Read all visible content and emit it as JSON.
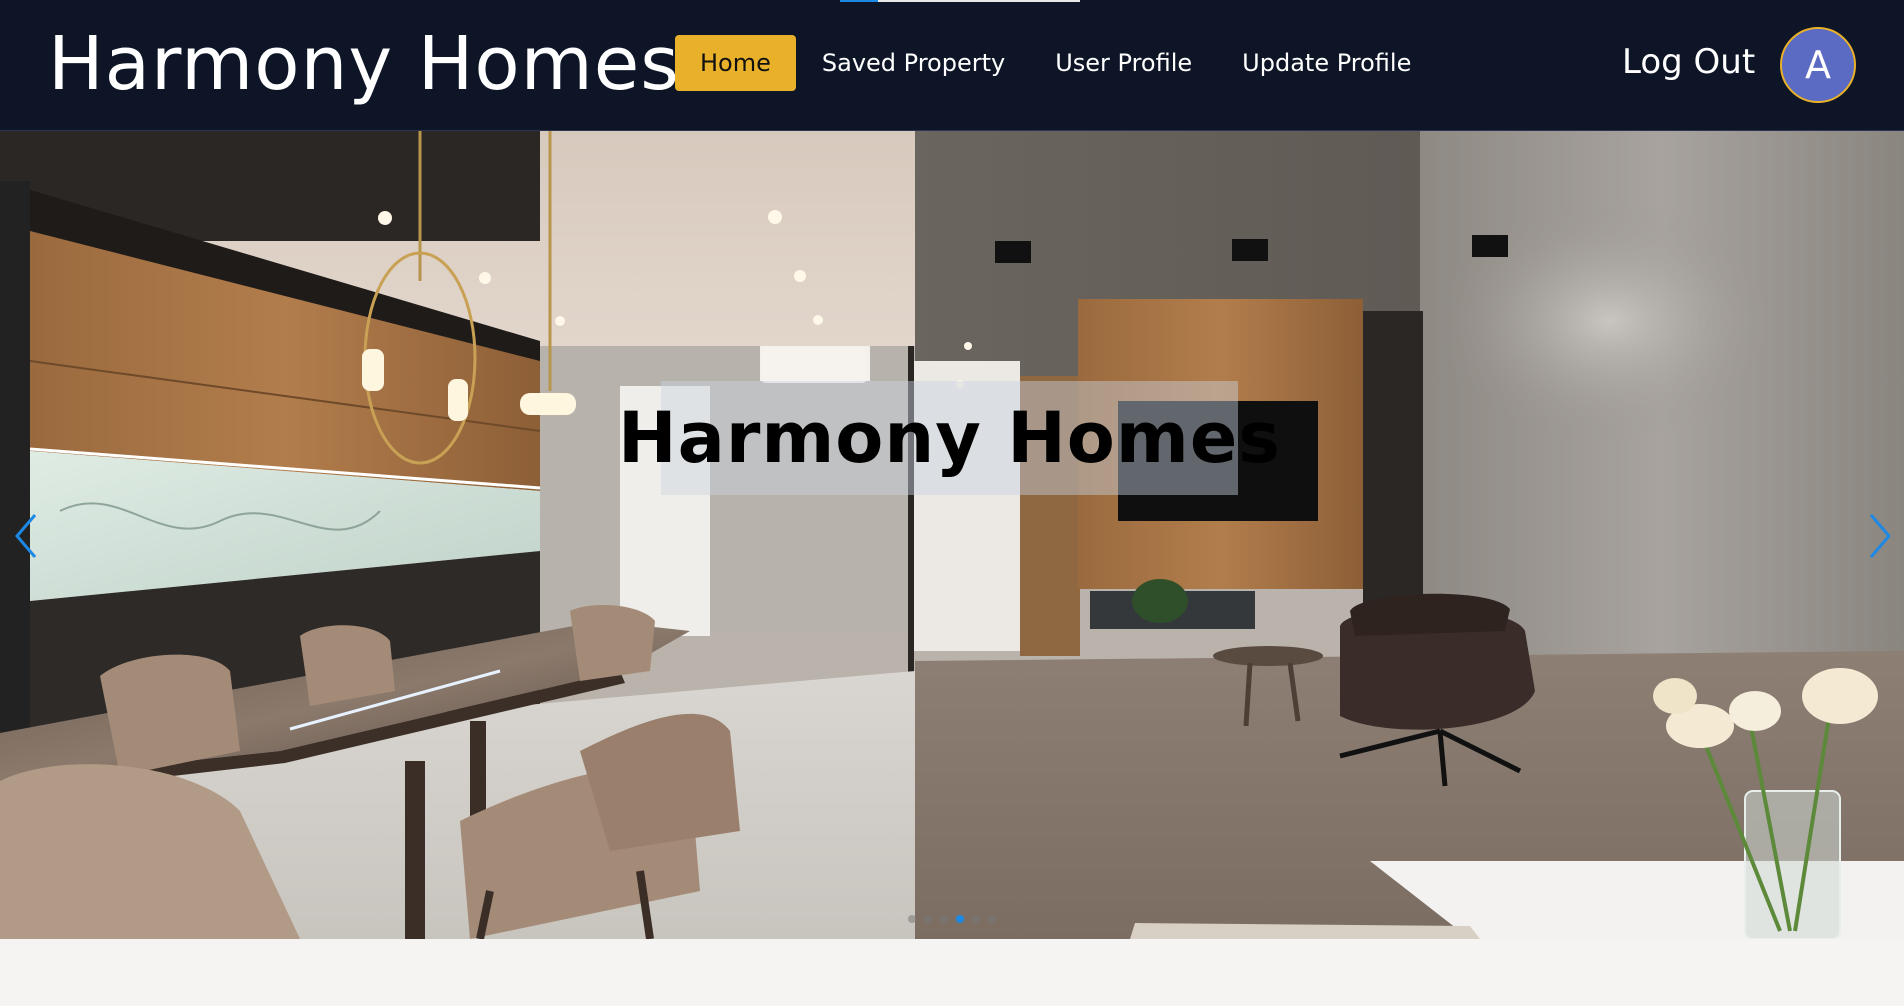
{
  "header": {
    "brand": "Harmony Homes",
    "nav": [
      {
        "label": "Home",
        "active": true
      },
      {
        "label": "Saved Property",
        "active": false
      },
      {
        "label": "User Profile",
        "active": false
      },
      {
        "label": "Update Profile",
        "active": false
      }
    ],
    "logout_label": "Log Out",
    "avatar_initial": "A",
    "colors": {
      "background": "#0d1527",
      "active_nav": "#e9b12a",
      "avatar": "#5b6ac2"
    },
    "page_load_progress": 0.16
  },
  "hero": {
    "caption": "Harmony Homes",
    "prev_icon": "chevron-left-icon",
    "next_icon": "chevron-right-icon",
    "slide_count": 6,
    "active_slide": 4,
    "accent": "#1e88e5"
  }
}
